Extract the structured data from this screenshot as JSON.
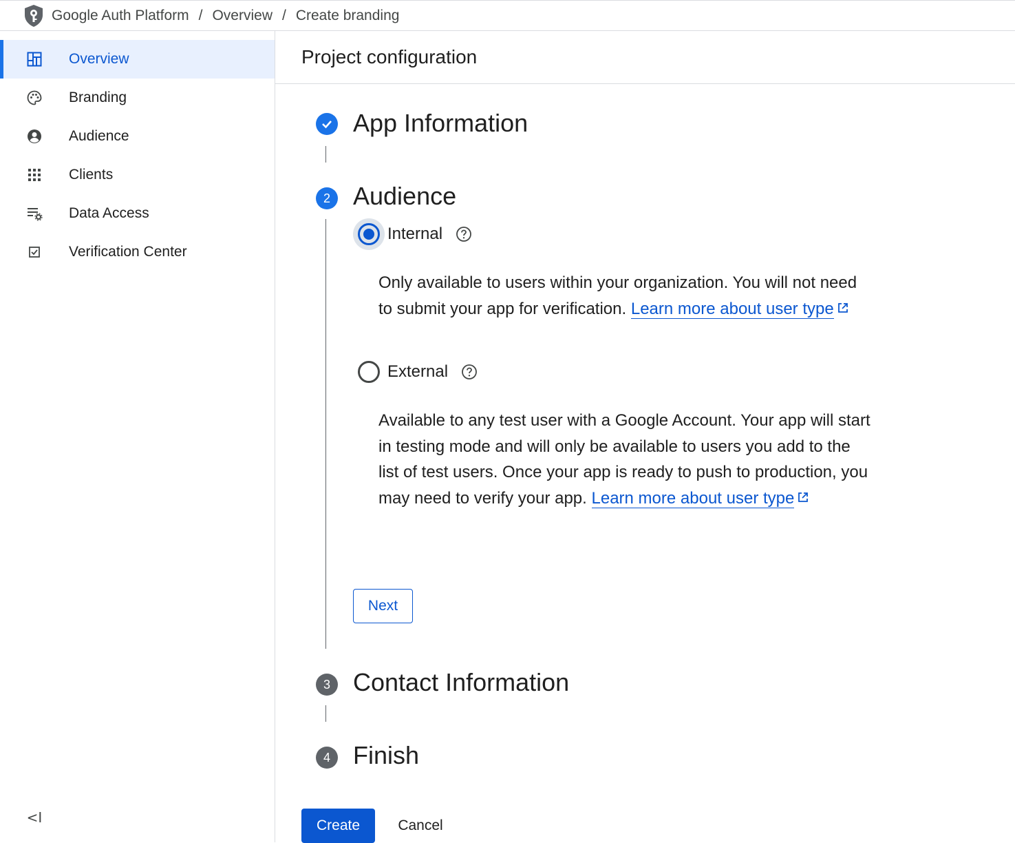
{
  "breadcrumb": {
    "items": [
      "Google Auth Platform",
      "Overview",
      "Create branding"
    ],
    "separator": "/"
  },
  "sidebar": {
    "items": [
      {
        "label": "Overview",
        "icon": "dashboard-icon",
        "active": true
      },
      {
        "label": "Branding",
        "icon": "palette-icon",
        "active": false
      },
      {
        "label": "Audience",
        "icon": "account-circle-icon",
        "active": false
      },
      {
        "label": "Clients",
        "icon": "apps-grid-icon",
        "active": false
      },
      {
        "label": "Data Access",
        "icon": "list-settings-icon",
        "active": false
      },
      {
        "label": "Verification Center",
        "icon": "checkbox-icon",
        "active": false
      }
    ],
    "collapse_label": "<I"
  },
  "page": {
    "title": "Project configuration"
  },
  "steps": [
    {
      "number": "",
      "title": "App Information",
      "state": "done"
    },
    {
      "number": "2",
      "title": "Audience",
      "state": "current"
    },
    {
      "number": "3",
      "title": "Contact Information",
      "state": "pending"
    },
    {
      "number": "4",
      "title": "Finish",
      "state": "pending"
    }
  ],
  "audience": {
    "internal": {
      "label": "Internal",
      "selected": true,
      "description": "Only available to users within your organization. You will not need to submit your app for verification. ",
      "link": "Learn more about user type"
    },
    "external": {
      "label": "External",
      "selected": false,
      "description": "Available to any test user with a Google Account. Your app will start in testing mode and will only be available to users you add to the list of test users. Once your app is ready to push to production, you may need to verify your app. ",
      "link": "Learn more about user type"
    },
    "next_label": "Next"
  },
  "actions": {
    "create_label": "Create",
    "cancel_label": "Cancel"
  },
  "colors": {
    "accent": "#0b57d0",
    "active_nav_bg": "#e8f0fe",
    "pending_step": "#5f6368"
  }
}
